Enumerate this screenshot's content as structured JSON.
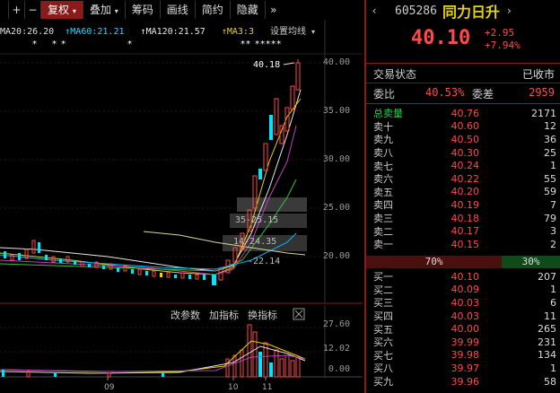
{
  "toolbar": {
    "items": [
      {
        "label": "+"
      },
      {
        "label": "−"
      },
      {
        "label": "复权",
        "active": true
      },
      {
        "label": "叠加"
      },
      {
        "label": "筹码"
      },
      {
        "label": "画线"
      },
      {
        "label": "简约"
      },
      {
        "label": "隐藏"
      }
    ],
    "nav_right": "»"
  },
  "ma_bar": {
    "ma20": "MA20:26.20",
    "ma60": "MA60:21.21",
    "ma120": "MA120:21.57",
    "ma3": "MA3:3",
    "settings": "设置均线",
    "colors": {
      "ma20": "#e0e0e0",
      "ma60": "#00e5ff",
      "ma120": "#e8e8e8",
      "ma3": "#e8d400"
    }
  },
  "price_axis": [
    "40.00",
    "35.00",
    "30.00",
    "25.00",
    "20.00"
  ],
  "volume_axis": [
    "27.60",
    "12.02",
    "0.00"
  ],
  "annotations": {
    "high_price": "40.18",
    "chip_band_1": "35-25.15",
    "chip_band_2": "14-24.35",
    "chip_band_3": "-22.14"
  },
  "stars_groups": [
    "*",
    "* *",
    "*",
    "** *****"
  ],
  "indicator_toolbar": {
    "change_params": "改参数",
    "add_indicator": "加指标",
    "switch_indicator": "换指标"
  },
  "x_axis": {
    "labels": [
      "09",
      "10",
      "11"
    ]
  },
  "stock": {
    "code": "605286",
    "name": "同力日升",
    "price": "40.10",
    "change": "+2.95",
    "change_pct": "+7.94%"
  },
  "status": {
    "label": "交易状态",
    "value": "已收市",
    "ratio_label": "委比",
    "ratio_value": "40.53%",
    "diff_label": "委差",
    "diff_value": "2959"
  },
  "sell_orders": [
    {
      "label": "总卖量",
      "price": "40.76",
      "volume": "2171"
    },
    {
      "label": "卖十",
      "price": "40.60",
      "volume": "12"
    },
    {
      "label": "卖九",
      "price": "40.50",
      "volume": "36"
    },
    {
      "label": "卖八",
      "price": "40.30",
      "volume": "25"
    },
    {
      "label": "卖七",
      "price": "40.24",
      "volume": "1"
    },
    {
      "label": "卖六",
      "price": "40.22",
      "volume": "55"
    },
    {
      "label": "卖五",
      "price": "40.20",
      "volume": "59"
    },
    {
      "label": "卖四",
      "price": "40.19",
      "volume": "7"
    },
    {
      "label": "卖三",
      "price": "40.18",
      "volume": "79"
    },
    {
      "label": "卖二",
      "price": "40.17",
      "volume": "3"
    },
    {
      "label": "卖一",
      "price": "40.15",
      "volume": "2"
    }
  ],
  "ratio_bar": {
    "buy_pct": "70%",
    "sell_pct": "30%",
    "buy_fraction": 0.7
  },
  "buy_orders": [
    {
      "label": "买一",
      "price": "40.10",
      "volume": "207"
    },
    {
      "label": "买二",
      "price": "40.09",
      "volume": "1"
    },
    {
      "label": "买三",
      "price": "40.03",
      "volume": "6"
    },
    {
      "label": "买四",
      "price": "40.03",
      "volume": "11"
    },
    {
      "label": "买五",
      "price": "40.00",
      "volume": "265"
    },
    {
      "label": "买六",
      "price": "39.99",
      "volume": "231"
    },
    {
      "label": "买七",
      "price": "39.98",
      "volume": "134"
    },
    {
      "label": "买八",
      "price": "39.97",
      "volume": "1"
    },
    {
      "label": "买九",
      "price": "39.96",
      "volume": "58"
    }
  ]
}
